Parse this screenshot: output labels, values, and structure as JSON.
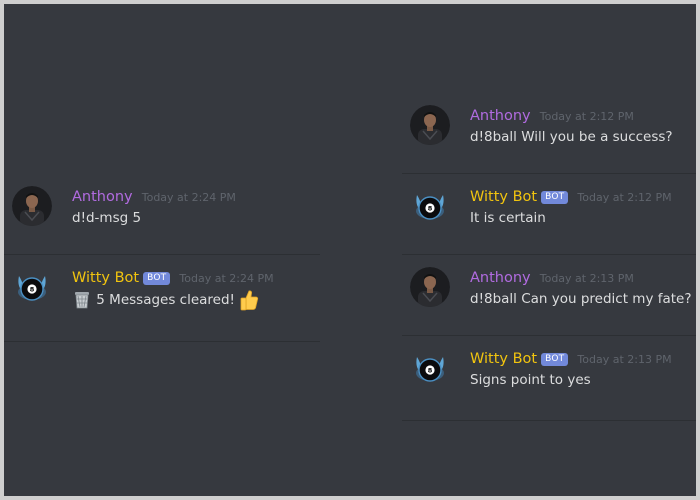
{
  "left_panel": {
    "messages": [
      {
        "author": "Anthony",
        "timestamp": "Today at 2:24 PM",
        "text": "d!d-msg 5"
      },
      {
        "author": "Witty Bot",
        "bot_tag": "BOT",
        "timestamp": "Today at 2:24 PM",
        "text": "5 Messages cleared!",
        "leading_emoji": "wastebasket-icon",
        "trailing_emoji": "thumbs-up-icon"
      }
    ]
  },
  "right_panel": {
    "messages": [
      {
        "author": "Anthony",
        "timestamp": "Today at 2:12 PM",
        "text": "d!8ball Will you be a success?"
      },
      {
        "author": "Witty Bot",
        "bot_tag": "BOT",
        "timestamp": "Today at 2:12 PM",
        "text": "It is certain"
      },
      {
        "author": "Anthony",
        "timestamp": "Today at 2:13 PM",
        "text": "d!8ball Can you predict my fate?"
      },
      {
        "author": "Witty Bot",
        "bot_tag": "BOT",
        "timestamp": "Today at 2:13 PM",
        "text": "Signs point to yes"
      }
    ]
  },
  "colors": {
    "background": "#36393f",
    "user_name": "#b16be0",
    "bot_name": "#f1c40f",
    "bot_tag": "#7289da",
    "message_text": "#dcddde",
    "timestamp": "#5f646c"
  }
}
